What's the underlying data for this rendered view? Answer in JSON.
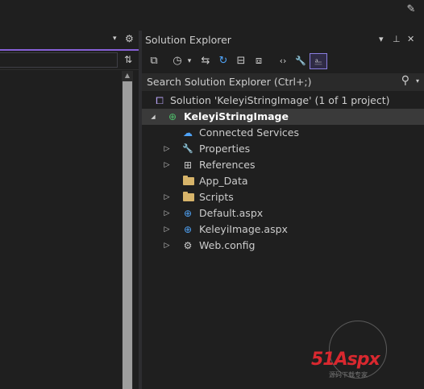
{
  "colors": {
    "accent": "#8660d6",
    "folder": "#d7b46a",
    "selected_row": "#3a3a3a",
    "watermark_red": "#d9282f"
  },
  "top_right_icon": "feedback-icon",
  "left_pane": {
    "dropdown_glyph": "▾",
    "gear_glyph": "⚙",
    "split_glyph": "⇅",
    "scroll_up_glyph": "▲"
  },
  "solution_explorer": {
    "title": "Solution Explorer",
    "window_buttons": {
      "dropdown": "▾",
      "pin": "⊥",
      "close": "✕"
    },
    "toolbar": [
      {
        "name": "switch-views-icon",
        "glyph": "⧉"
      },
      {
        "name": "pending-changes-filter-icon",
        "glyph": "◷"
      },
      {
        "name": "dropdown-icon",
        "glyph": "▾"
      },
      {
        "name": "sync-active-document-icon",
        "glyph": "⇆"
      },
      {
        "name": "refresh-icon",
        "glyph": "↻"
      },
      {
        "name": "collapse-all-icon",
        "glyph": "⊟"
      },
      {
        "name": "show-all-files-icon",
        "glyph": "⧈"
      },
      {
        "name": "code-view-icon",
        "glyph": "‹›"
      },
      {
        "name": "properties-wrench-icon",
        "glyph": "🔧"
      },
      {
        "name": "preview-selected-items-icon",
        "glyph": "⎁"
      }
    ],
    "search_placeholder": "Search Solution Explorer (Ctrl+;)",
    "search_icon_glyph": "⚲",
    "search_dd_glyph": "▾",
    "tree": [
      {
        "label": "Solution 'KeleyiStringImage' (1 of 1 project)",
        "icon": "solution-icon",
        "glyph": "⧠",
        "arrow": "",
        "indent": 0
      },
      {
        "label": "KeleyiStringImage",
        "icon": "web-project-icon",
        "glyph": "⊕",
        "arrow": "◢",
        "indent": 1,
        "selected": true,
        "bold": true
      },
      {
        "label": "Connected Services",
        "icon": "connected-services-icon",
        "glyph": "☁",
        "arrow": "",
        "indent": 2
      },
      {
        "label": "Properties",
        "icon": "wrench-icon",
        "glyph": "🔧",
        "arrow": "▷",
        "indent": 2
      },
      {
        "label": "References",
        "icon": "references-icon",
        "glyph": "⊞",
        "arrow": "▷",
        "indent": 2
      },
      {
        "label": "App_Data",
        "icon": "folder-icon",
        "glyph": "",
        "arrow": "",
        "indent": 2
      },
      {
        "label": "Scripts",
        "icon": "folder-icon",
        "glyph": "",
        "arrow": "▷",
        "indent": 2
      },
      {
        "label": "Default.aspx",
        "icon": "globe-icon",
        "glyph": "⊕",
        "arrow": "▷",
        "indent": 2
      },
      {
        "label": "KeleyiImage.aspx",
        "icon": "globe-icon",
        "glyph": "⊕",
        "arrow": "▷",
        "indent": 2
      },
      {
        "label": "Web.config",
        "icon": "config-file-icon",
        "glyph": "⚙",
        "arrow": "▷",
        "indent": 2
      }
    ]
  },
  "watermark": {
    "brand": "51Aspx",
    "subtitle": "源码下载专家"
  }
}
